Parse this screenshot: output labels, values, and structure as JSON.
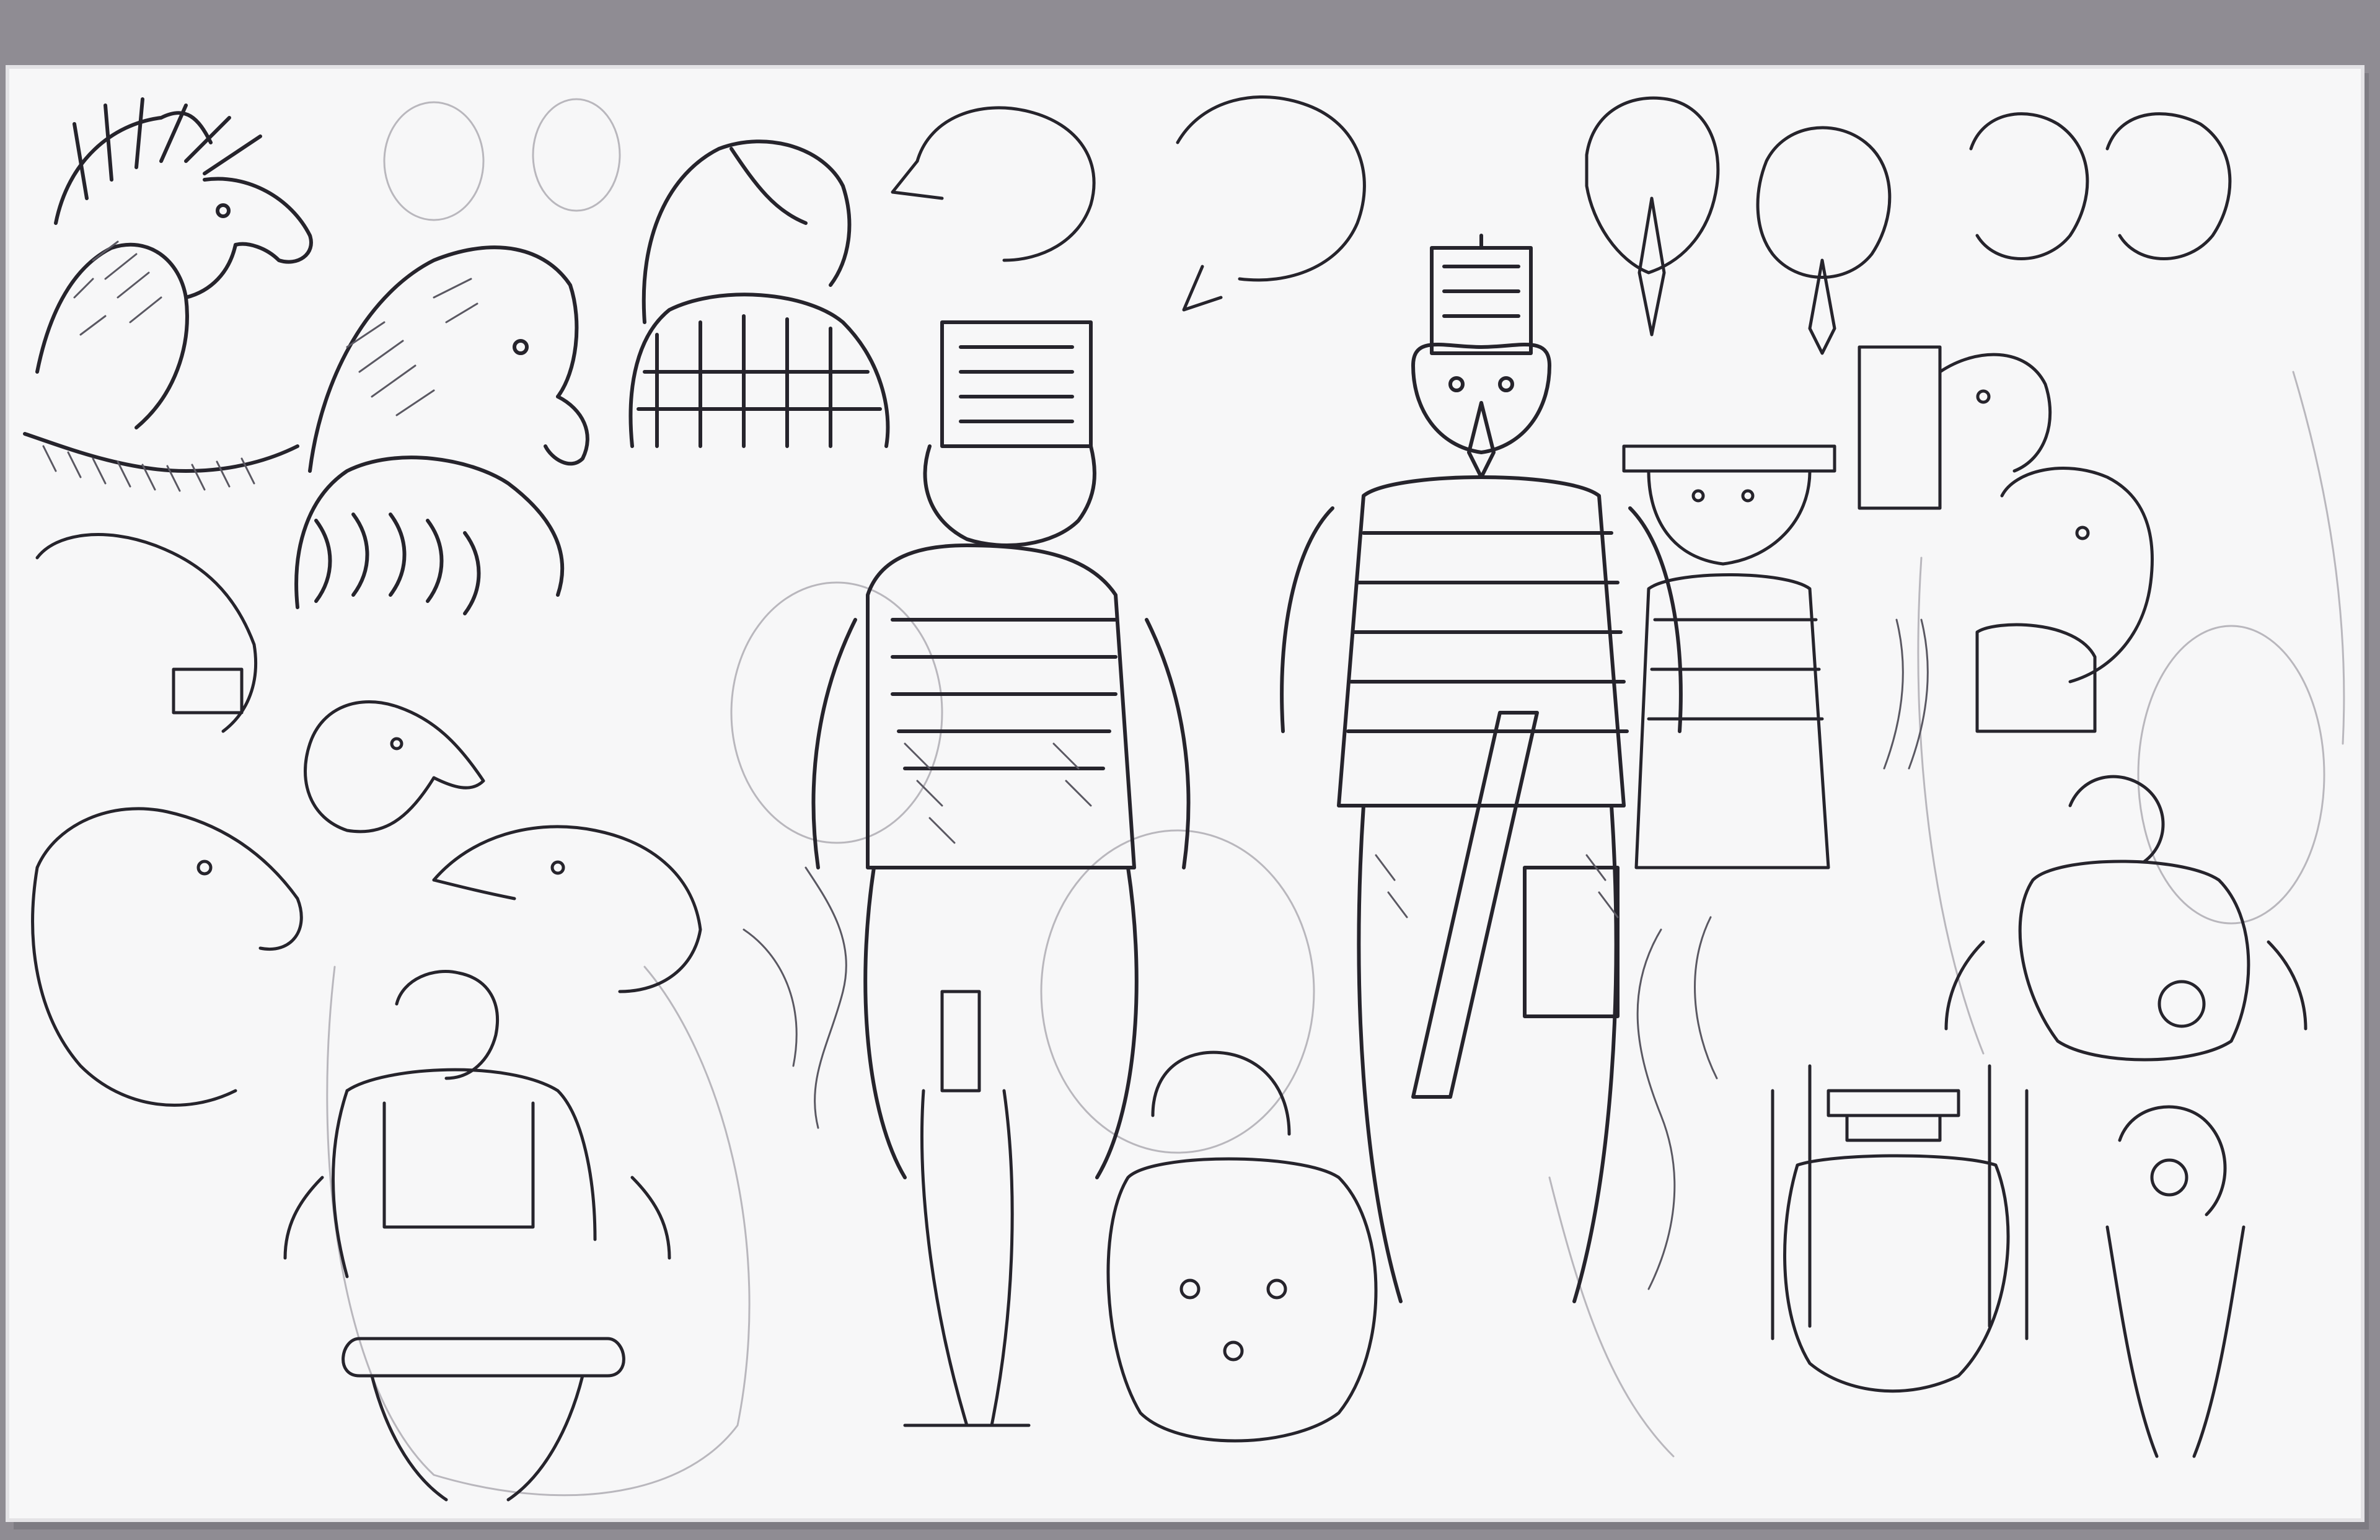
{
  "scene": {
    "subject": "ink-sketchbook-page",
    "colors": {
      "backdrop": "#8f8c93",
      "paper": "#f7f7f8",
      "paper_edge": "#e4e3e6",
      "ink": "#26242c",
      "ink_light": "#5a5862",
      "pencil": "#b9b7bd"
    }
  }
}
